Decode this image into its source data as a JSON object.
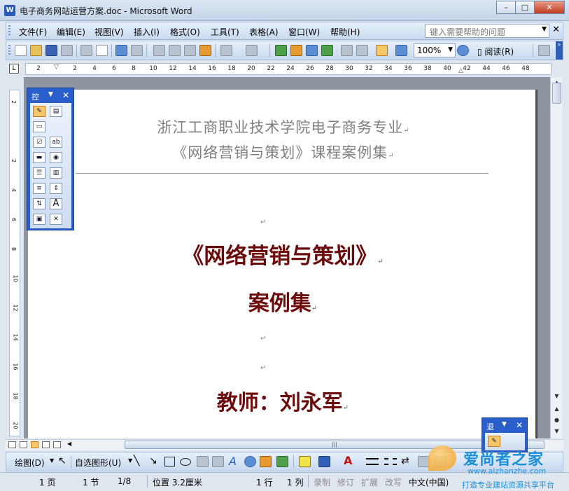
{
  "window": {
    "title": "电子商务网站运营方案.doc - Microsoft Word",
    "app_icon": "W",
    "minimize": "–",
    "maximize": "□",
    "close": "✕"
  },
  "menu": {
    "items": [
      "文件(F)",
      "编辑(E)",
      "视图(V)",
      "插入(I)",
      "格式(O)",
      "工具(T)",
      "表格(A)",
      "窗口(W)",
      "帮助(H)"
    ],
    "help_placeholder": "键入需要帮助的问题",
    "close": "✕"
  },
  "toolbar": {
    "zoom": "100%",
    "read": "阅读(R)"
  },
  "ruler": {
    "corner": "L",
    "h_labels": [
      "2",
      "2",
      "4",
      "6",
      "8",
      "10",
      "12",
      "14",
      "16",
      "18",
      "20",
      "22",
      "24",
      "26",
      "28",
      "30",
      "32",
      "34",
      "36",
      "38",
      "40",
      "42",
      "44",
      "46",
      "48"
    ],
    "v_labels": [
      "2",
      "2",
      "4",
      "6",
      "8",
      "10",
      "12",
      "14",
      "16",
      "18",
      "20"
    ]
  },
  "document": {
    "header_line1": "浙江工商职业技术学院电子商务专业",
    "header_line2": "《网络营销与策划》课程案例集",
    "title1": "《网络营销与策划》",
    "title2": "案例集",
    "teacher": "教师：刘永军",
    "para_mark": "↵"
  },
  "control_toolbox": {
    "title": "控",
    "close": "✕",
    "buttons": [
      "design-mode",
      "properties",
      "view-code",
      "checkbox",
      "textbox",
      "command-button",
      "option-button",
      "list-box",
      "combo-box",
      "toggle-button",
      "spin-button",
      "scroll-bar",
      "label",
      "image",
      "more-controls"
    ]
  },
  "exit_design": {
    "title": "退",
    "close": "✕"
  },
  "drawing_toolbar": {
    "draw": "绘图(D)",
    "autoshapes": "自选图形(U)"
  },
  "statusbar": {
    "page": "1 页",
    "section": "1 节",
    "pages": "1/8",
    "position": "位置 3.2厘米",
    "line": "1 行",
    "column": "1 列",
    "rec": "录制",
    "trk": "修订",
    "ext": "扩展",
    "ovr": "改写",
    "language": "中文(中国)"
  },
  "watermark": {
    "brand": "爱尚者之家",
    "url": "www.aizhanzhe.com",
    "slogan": "打造专业建站资源共享平台"
  },
  "colors": {
    "title_red": "#6b0b0b",
    "header_gray": "#808080",
    "toolbar_blue": "#c9d9ef",
    "floating_blue": "#2a5ecb"
  }
}
